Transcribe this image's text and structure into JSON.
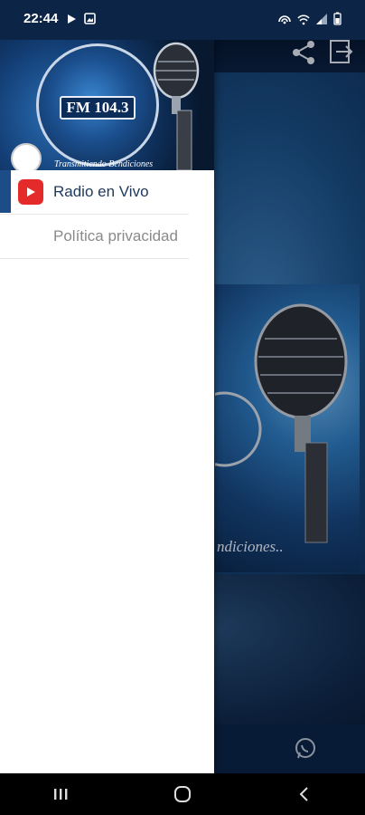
{
  "status_bar": {
    "time": "22:44"
  },
  "drawer": {
    "header": {
      "fm_label": "FM 104.3",
      "tagline": "Transmitiendo Bendiciones"
    },
    "items": [
      {
        "label": "Radio en Vivo",
        "icon": "youtube-play-icon",
        "active": true
      },
      {
        "label": "Política privacidad",
        "active": false
      }
    ]
  },
  "background_app": {
    "cover_text": "ndiciones.."
  },
  "colors": {
    "accent": "#1d4d86",
    "youtube_red": "#e52a2a",
    "statusbar": "#0c2446"
  }
}
